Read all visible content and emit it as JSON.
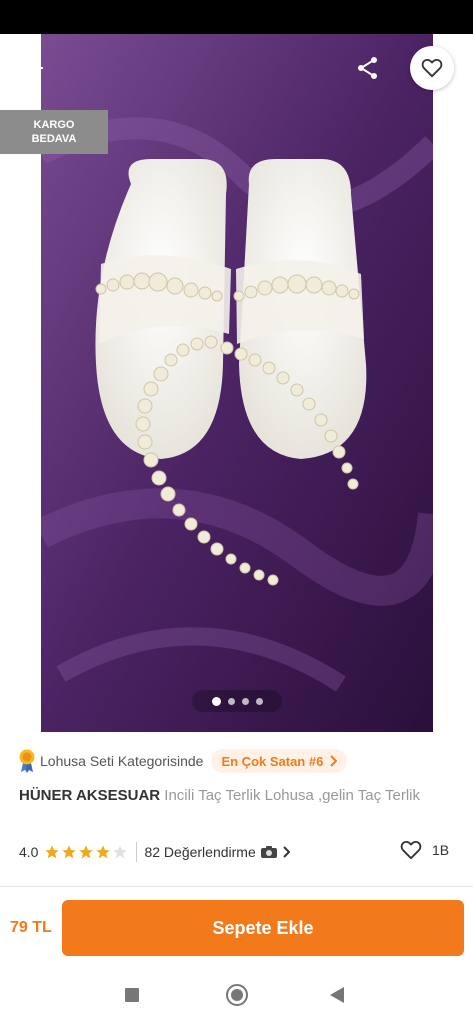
{
  "product": {
    "badge": {
      "line1": "KARGO",
      "line2": "BEDAVA"
    },
    "gallery": {
      "total_images": 4,
      "active_index": 0
    },
    "category": {
      "text": "Lohusa Seti Kategorisinde",
      "bestseller": "En Çok Satan #6"
    },
    "brand": "HÜNER AKSESUAR",
    "name": "Incili Taç Terlik Lohusa ,gelin Taç Terlik",
    "rating": {
      "value": "4.0",
      "stars": 4,
      "max_stars": 5,
      "reviews": "82 Değerlendirme"
    },
    "likes": "1B"
  },
  "cart": {
    "price": "79 TL",
    "button_label": "Sepete Ekle"
  },
  "colors": {
    "accent": "#f27a1a",
    "badge_bg": "#8c8c8c",
    "star": "#f2a81a"
  },
  "icons": {
    "back": "back-arrow-icon",
    "share": "share-icon",
    "favorite": "heart-icon",
    "medal": "medal-icon",
    "chevron": "chevron-right-icon",
    "camera": "camera-icon"
  }
}
